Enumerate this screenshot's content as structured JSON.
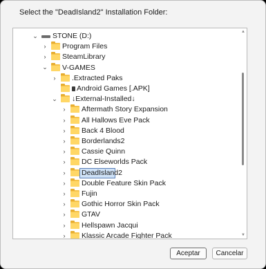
{
  "dialog": {
    "prompt": "Select the \"DeadIsland2\" Installation Folder:",
    "accept_label": "Aceptar",
    "cancel_label": "Cancelar"
  },
  "tree": {
    "items": [
      {
        "label": "STONE (D:)",
        "icon": "drive-icon",
        "expanded": true
      },
      {
        "label": "Program Files",
        "icon": "folder-icon",
        "expanded": false
      },
      {
        "label": "SteamLibrary",
        "icon": "folder-icon",
        "expanded": false
      },
      {
        "label": "V-GAMES",
        "icon": "folder-icon",
        "expanded": true
      },
      {
        "label": ".Extracted Paks",
        "icon": "folder-icon",
        "expanded": false
      },
      {
        "label": "Android Games [.APK]",
        "icon": "apk-icon",
        "expanded": false
      },
      {
        "label": "↓External-Installed↓",
        "icon": "folder-icon",
        "expanded": true
      },
      {
        "label": "Aftermath Story Expansion",
        "icon": "folder-icon",
        "expanded": false
      },
      {
        "label": "All Hallows Eve Pack",
        "icon": "folder-icon",
        "expanded": false
      },
      {
        "label": "Back 4 Blood",
        "icon": "folder-icon",
        "expanded": false
      },
      {
        "label": "Borderlands2",
        "icon": "folder-icon",
        "expanded": false
      },
      {
        "label": "Cassie Quinn",
        "icon": "folder-icon",
        "expanded": false
      },
      {
        "label": "DC Elseworlds Pack",
        "icon": "folder-icon",
        "expanded": false
      },
      {
        "label": "DeadIsland2",
        "icon": "folder-icon",
        "expanded": false,
        "selected": true
      },
      {
        "label": "Double Feature Skin Pack",
        "icon": "folder-icon",
        "expanded": false
      },
      {
        "label": "Fujin",
        "icon": "folder-icon",
        "expanded": false
      },
      {
        "label": "Gothic Horror Skin Pack",
        "icon": "folder-icon",
        "expanded": false
      },
      {
        "label": "GTAV",
        "icon": "folder-icon",
        "expanded": false
      },
      {
        "label": "Hellspawn Jacqui",
        "icon": "folder-icon",
        "expanded": false
      },
      {
        "label": "Klassic Arcade Fighter Pack",
        "icon": "folder-icon",
        "expanded": false
      }
    ]
  },
  "colors": {
    "selection_fill": "#cfe2f7",
    "selection_border": "#5a7fb8",
    "folder": "#ffd766"
  }
}
